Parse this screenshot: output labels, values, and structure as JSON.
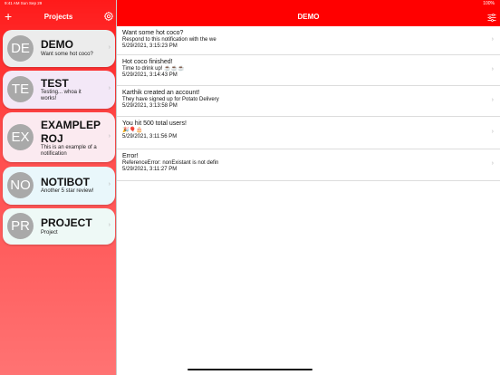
{
  "status": {
    "time_date": "9:41 AM   Sun Sep 29",
    "right": "100%"
  },
  "sidebar": {
    "title": "Projects",
    "add_label": "+",
    "projects": [
      {
        "initials": "DE",
        "name": "DEMO",
        "subtitle": "Want some hot coco?",
        "bg": "#ececec"
      },
      {
        "initials": "TE",
        "name": "TEST",
        "subtitle": "Testing... whoa it works!",
        "bg": "#f3e8f7"
      },
      {
        "initials": "EX",
        "name": "EXAMPLEPROJ",
        "subtitle": "This is an example of a notification",
        "bg": "#fbeaf0"
      },
      {
        "initials": "NO",
        "name": "NOTIBOT",
        "subtitle": "Another 5 star review!",
        "bg": "#e9f7fb"
      },
      {
        "initials": "PR",
        "name": "PROJECT",
        "subtitle": "Project",
        "bg": "#eef9f6"
      }
    ]
  },
  "main": {
    "title": "DEMO",
    "notifications": [
      {
        "title": "Want some hot coco?",
        "message": "Respond to this notification with the we",
        "date": "5/29/2021, 3:15:23 PM"
      },
      {
        "title": "Hot coco finished!",
        "message": "Time to drink up! ☕☕☕",
        "date": "5/29/2021, 3:14:43 PM"
      },
      {
        "title": "Karthik created an account!",
        "message": "They have signed up for Potato Delivery",
        "date": "5/29/2021, 3:13:58 PM"
      },
      {
        "title": "You hit 500 total users!",
        "message": "🎉🎈🎂",
        "date": "5/29/2021, 3:11:56 PM"
      },
      {
        "title": "Error!",
        "message": "ReferenceError: nonExistant is not defin",
        "date": "5/29/2021, 3:11:27 PM"
      }
    ]
  },
  "colors": {
    "accent": "#ff0000",
    "avatar": "#a9a9a9"
  },
  "icons": {
    "add": "plus-icon",
    "settings": "gear-icon",
    "filter": "filter-icon",
    "disclosure": "chevron-right-icon"
  }
}
